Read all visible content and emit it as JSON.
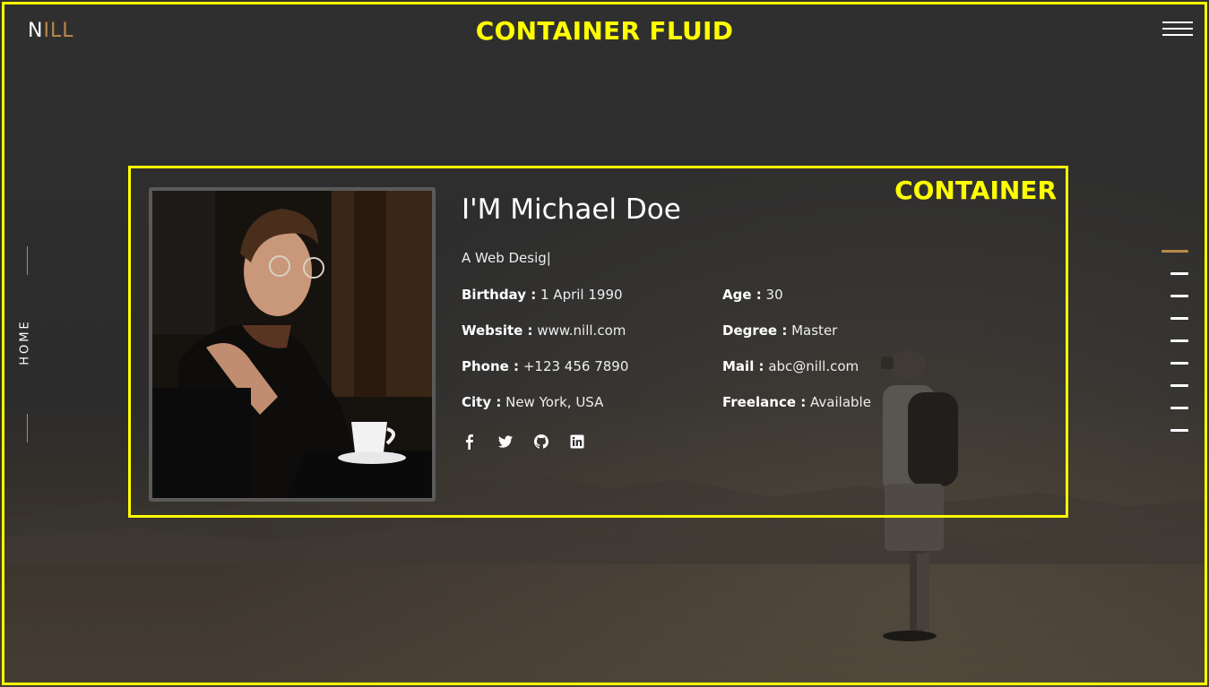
{
  "brand": {
    "logo_part1": "N",
    "logo_part2": "ILL"
  },
  "labels": {
    "container_fluid": "CONTAINER FLUID",
    "container": "CONTAINER"
  },
  "side_nav": {
    "home_label": "HOME"
  },
  "section_nav": {
    "active_index": 0,
    "count": 9
  },
  "profile": {
    "name": "I'M Michael Doe",
    "role_typed": "A Web Desig|",
    "details": {
      "birthday": {
        "label": "Birthday :",
        "value": "1 April 1990"
      },
      "website": {
        "label": "Website :",
        "value": "www.nill.com"
      },
      "phone": {
        "label": "Phone :",
        "value": "+123 456 7890"
      },
      "city": {
        "label": "City :",
        "value": "New York, USA"
      },
      "age": {
        "label": "Age :",
        "value": "30"
      },
      "degree": {
        "label": "Degree :",
        "value": "Master"
      },
      "mail": {
        "label": "Mail :",
        "value": "abc@nill.com"
      },
      "freelance": {
        "label": "Freelance :",
        "value": "Available"
      }
    },
    "socials": [
      "facebook-icon",
      "twitter-icon",
      "github-icon",
      "linkedin-icon"
    ]
  },
  "colors": {
    "highlight": "#ffff00",
    "accent": "#b88a47",
    "background": "#2e2e2e"
  }
}
